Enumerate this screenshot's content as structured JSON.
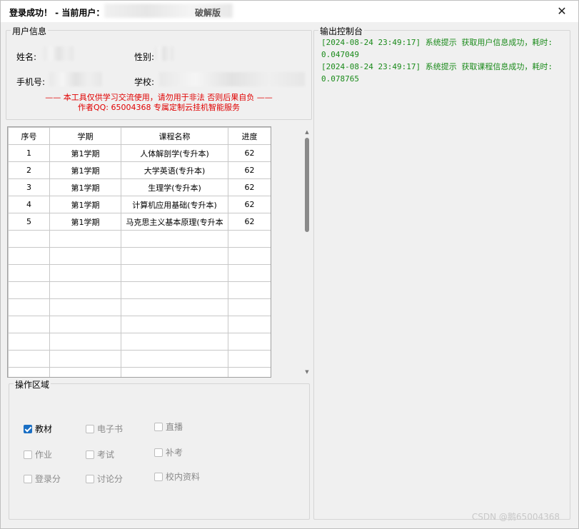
{
  "window": {
    "title": "登录成功！ - 当前用户：",
    "title_suffix": "破解版",
    "close_glyph": "✕"
  },
  "user_info": {
    "legend": "用户信息",
    "name_label": "姓名:",
    "gender_label": "性别:",
    "phone_label": "手机号:",
    "school_label": "学校:",
    "warning_line1": "—— 本工具仅供学习交流使用，请勿用于非法 否则后果自负 ——",
    "warning_line2": "作者QQ: 65004368 专属定制云挂机智能服务"
  },
  "table": {
    "columns": [
      "序号",
      "学期",
      "课程名称",
      "进度"
    ],
    "rows": [
      [
        "1",
        "第1学期",
        "人体解剖学(专升本)",
        "62"
      ],
      [
        "2",
        "第1学期",
        "大学英语(专升本)",
        "62"
      ],
      [
        "3",
        "第1学期",
        "生理学(专升本)",
        "62"
      ],
      [
        "4",
        "第1学期",
        "计算机应用基础(专升本)",
        "62"
      ],
      [
        "5",
        "第1学期",
        "马克思主义基本原理(专升本",
        "62"
      ]
    ],
    "empty_rows": 9
  },
  "ops": {
    "legend": "操作区域",
    "options": [
      {
        "label": "教材",
        "checked": true
      },
      {
        "label": "电子书",
        "checked": false
      },
      {
        "label": "直播",
        "checked": false
      },
      {
        "label": "作业",
        "checked": false
      },
      {
        "label": "考试",
        "checked": false
      },
      {
        "label": "补考",
        "checked": false
      },
      {
        "label": "登录分",
        "checked": false
      },
      {
        "label": "讨论分",
        "checked": false
      },
      {
        "label": "校内资料",
        "checked": false
      }
    ]
  },
  "console": {
    "legend": "输出控制台",
    "lines": [
      "[2024-08-24 23:49:17] 系统提示 获取用户信息成功，耗时: 0.047049",
      "[2024-08-24 23:49:17] 系统提示 获取课程信息成功，耗时: 0.078765"
    ]
  },
  "watermark": "CSDN @鹅65004368"
}
